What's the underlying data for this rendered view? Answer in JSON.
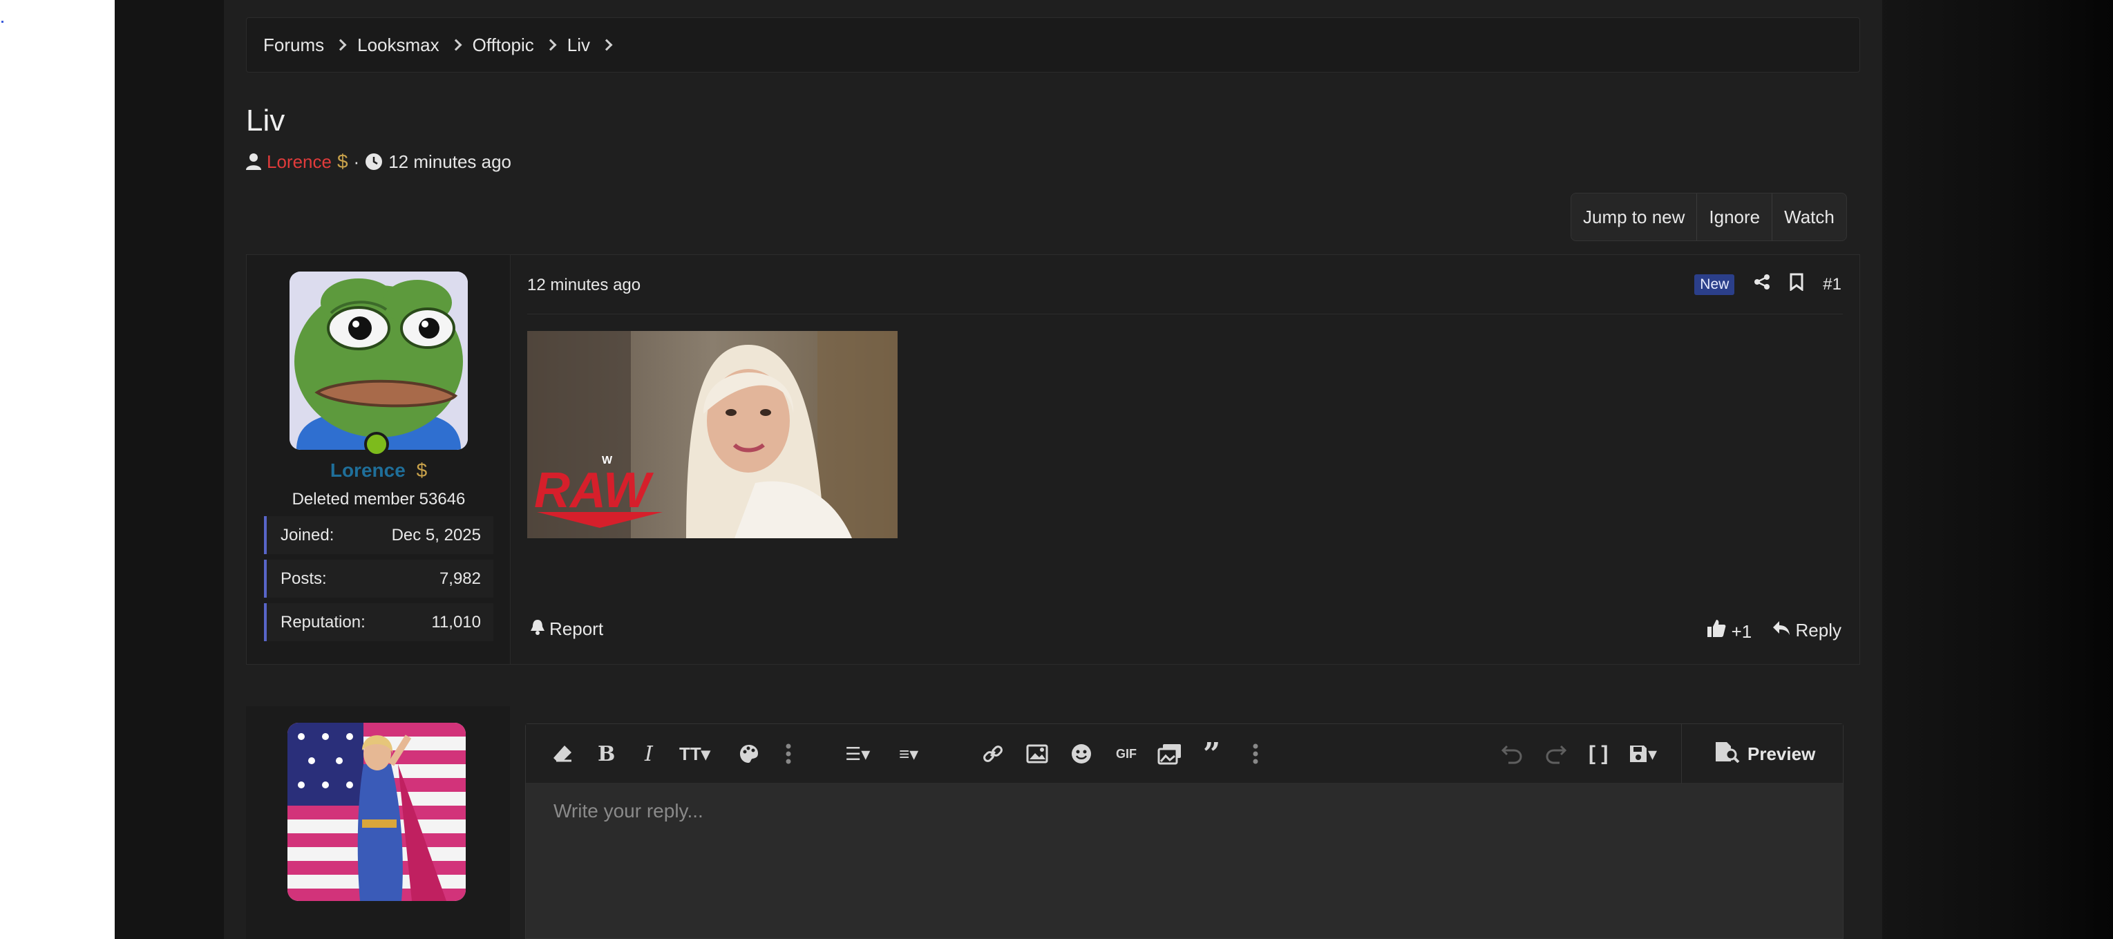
{
  "breadcrumb": [
    "Forums",
    "Looksmax",
    "Offtopic",
    "Liv"
  ],
  "thread": {
    "title": "Liv",
    "author": "Lorence",
    "author_badge": "$",
    "time": "12 minutes ago"
  },
  "thread_buttons": {
    "jump_to_new": "Jump to new",
    "ignore": "Ignore",
    "watch": "Watch"
  },
  "post": {
    "date": "12 minutes ago",
    "badge": "New",
    "number": "#1",
    "user": {
      "name": "Lorence",
      "badge": "$",
      "title": "Deleted member 53646",
      "stats": [
        {
          "label": "Joined:",
          "value": "Dec 5, 2025"
        },
        {
          "label": "Posts:",
          "value": "7,982"
        },
        {
          "label": "Reputation:",
          "value": "11,010"
        }
      ]
    },
    "image_logo_text": "RAW",
    "report": "Report",
    "reaction_count": "+1",
    "reply": "Reply"
  },
  "editor": {
    "placeholder": "Write your reply...",
    "preview": "Preview",
    "gif_label": "GIF"
  },
  "colors": {
    "author": "#e03b3b",
    "username_blue": "#1f6f9a",
    "online": "#7dbb1c",
    "badge_new": "#2b3f8a",
    "stat_accent": "#5865c8"
  }
}
